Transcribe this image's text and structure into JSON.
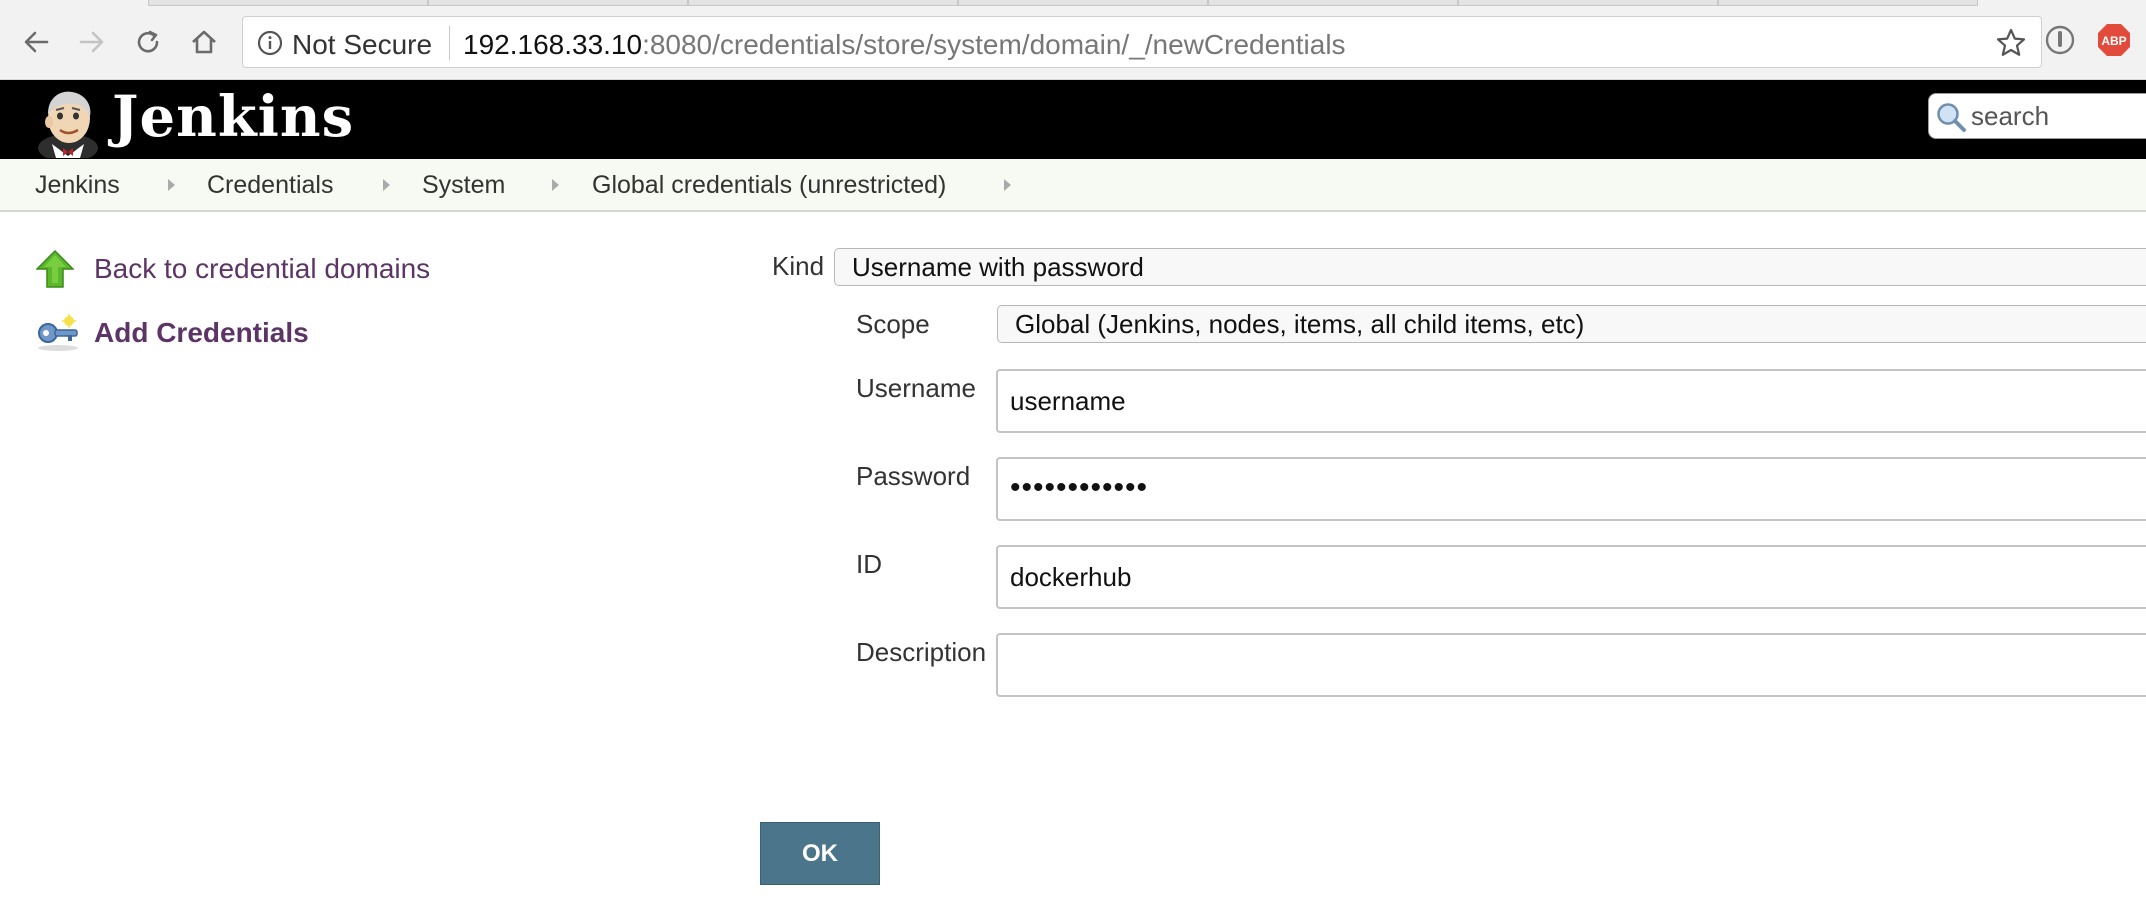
{
  "browser": {
    "security_label": "Not Secure",
    "url_host": "192.168.33.10",
    "url_rest": ":8080/credentials/store/system/domain/_/newCredentials",
    "extension_abp": "ABP"
  },
  "header": {
    "brand": "Jenkins",
    "search_placeholder": "search"
  },
  "breadcrumbs": [
    {
      "label": "Jenkins"
    },
    {
      "label": "Credentials"
    },
    {
      "label": "System"
    },
    {
      "label": "Global credentials (unrestricted)"
    }
  ],
  "sidebar": {
    "items": [
      {
        "label": "Back to credential domains",
        "icon": "up-arrow-icon"
      },
      {
        "label": "Add Credentials",
        "icon": "key-icon"
      }
    ]
  },
  "form": {
    "kind_label": "Kind",
    "kind_value": "Username with password",
    "scope_label": "Scope",
    "scope_value": "Global (Jenkins, nodes, items, all child items, etc)",
    "username_label": "Username",
    "username_value": "username",
    "password_label": "Password",
    "password_mask": "••••••••••••",
    "id_label": "ID",
    "id_value": "dockerhub",
    "description_label": "Description",
    "description_value": "",
    "ok_label": "OK"
  },
  "colors": {
    "link": "#5c3566",
    "ok_button": "#4b758b",
    "breadcrumb_bg": "#f6faf2",
    "header_bg": "#000000"
  }
}
